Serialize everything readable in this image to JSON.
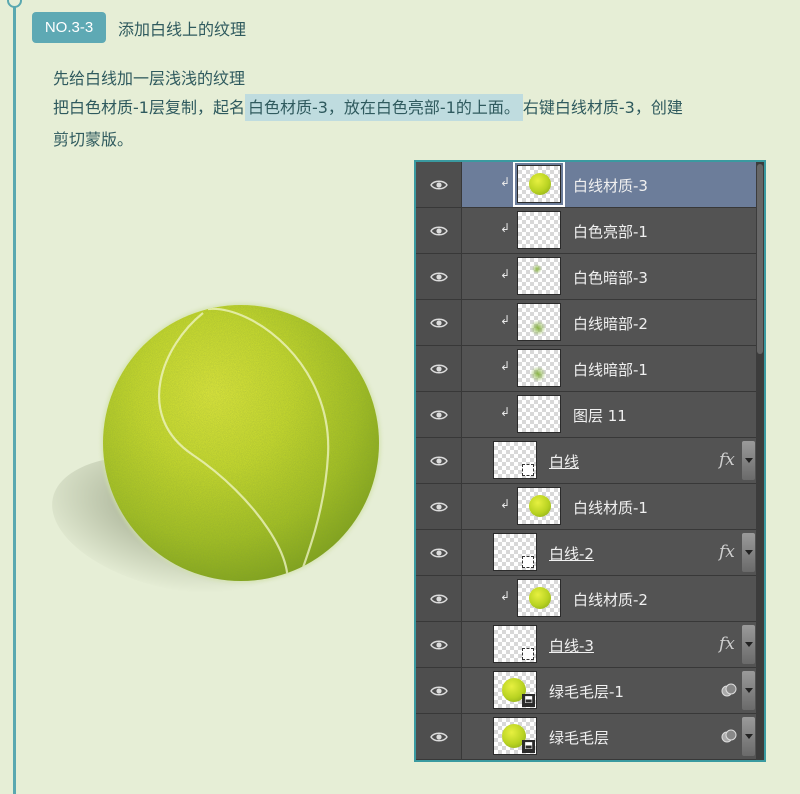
{
  "step": {
    "badge": "NO.3-3",
    "title": "添加白线上的纹理"
  },
  "description": {
    "line1": "先给白线加一层浅浅的纹理",
    "line2_before": "把白色材质-1层复制，起名",
    "line2_highlight": "白色材质-3，放在白色亮部-1的上面。",
    "line2_after": "右键白线材质-3，创建",
    "line3": "剪切蒙版。"
  },
  "colors": {
    "background": "#e6eed6",
    "accent": "#5ea9b4",
    "highlight": "#bfdcdf",
    "panel": "#535353",
    "selected_row": "#6c7d9a",
    "ball": "#c6dc28"
  },
  "layers_panel": {
    "layers": [
      {
        "name": "白线材质-3",
        "clipped": true,
        "selected": true,
        "thumb": "ball",
        "visible_icon": "eye-icon"
      },
      {
        "name": "白色亮部-1",
        "clipped": true,
        "selected": false,
        "thumb": "transparent",
        "visible_icon": "eye-icon"
      },
      {
        "name": "白色暗部-3",
        "clipped": true,
        "selected": false,
        "thumb": "blob-small",
        "visible_icon": "eye-icon"
      },
      {
        "name": "白线暗部-2",
        "clipped": true,
        "selected": false,
        "thumb": "blob",
        "visible_icon": "eye-icon"
      },
      {
        "name": "白线暗部-1",
        "clipped": true,
        "selected": false,
        "thumb": "blob",
        "visible_icon": "eye-icon"
      },
      {
        "name": "图层 11",
        "clipped": true,
        "selected": false,
        "thumb": "transparent",
        "visible_icon": "eye-icon"
      },
      {
        "name": "白线",
        "clipped": false,
        "selected": false,
        "thumb": "shape",
        "fx": "fx",
        "visible_icon": "eye-icon"
      },
      {
        "name": "白线材质-1",
        "clipped": true,
        "selected": false,
        "thumb": "ball",
        "visible_icon": "eye-icon"
      },
      {
        "name": "白线-2",
        "clipped": false,
        "selected": false,
        "thumb": "shape",
        "fx": "fx",
        "visible_icon": "eye-icon"
      },
      {
        "name": "白线材质-2",
        "clipped": true,
        "selected": false,
        "thumb": "ball",
        "visible_icon": "eye-icon"
      },
      {
        "name": "白线-3",
        "clipped": false,
        "selected": false,
        "thumb": "shape-mask",
        "fx": "fx",
        "visible_icon": "eye-icon"
      },
      {
        "name": "绿毛毛层-1",
        "clipped": false,
        "selected": false,
        "thumb": "smart-ball",
        "smart": true,
        "visible_icon": "eye-icon"
      },
      {
        "name": "绿毛毛层",
        "clipped": false,
        "selected": false,
        "thumb": "smart-ball",
        "smart": true,
        "visible_icon": "eye-icon"
      }
    ]
  }
}
